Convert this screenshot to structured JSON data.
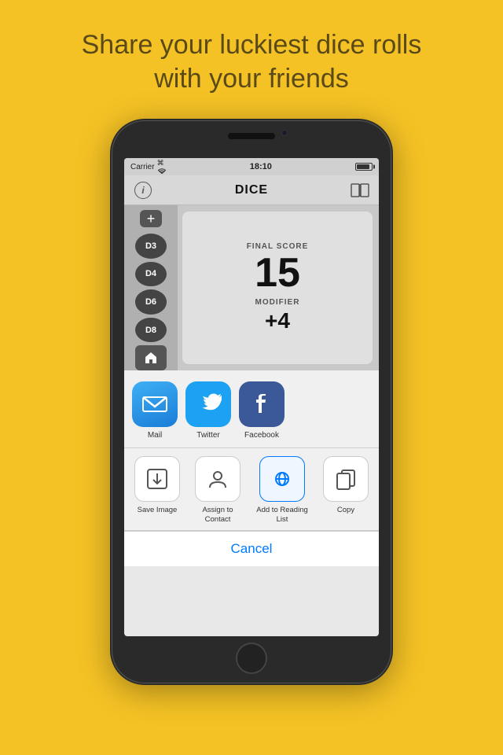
{
  "headline": {
    "line1": "Share your luckiest dice rolls",
    "line2": "with your friends"
  },
  "phone": {
    "status": {
      "carrier": "Carrier",
      "time": "18:10"
    },
    "nav": {
      "title": "DICE"
    },
    "dice": {
      "chips": [
        "D3",
        "D4",
        "D6",
        "D8"
      ]
    },
    "score": {
      "final_label": "FINAL SCORE",
      "final_value": "15",
      "modifier_label": "MODIFIER",
      "modifier_value": "+4"
    },
    "share": {
      "apps": [
        {
          "name": "Mail",
          "icon_type": "mail"
        },
        {
          "name": "Twitter",
          "icon_type": "twitter"
        },
        {
          "name": "Facebook",
          "icon_type": "facebook"
        }
      ],
      "actions": [
        {
          "name": "Save Image",
          "icon_type": "save"
        },
        {
          "name": "Assign to\nContact",
          "icon_type": "contact"
        },
        {
          "name": "Add to\nReading List",
          "icon_type": "reading",
          "highlight": true
        },
        {
          "name": "Copy",
          "icon_type": "copy"
        }
      ],
      "cancel": "Cancel"
    }
  }
}
